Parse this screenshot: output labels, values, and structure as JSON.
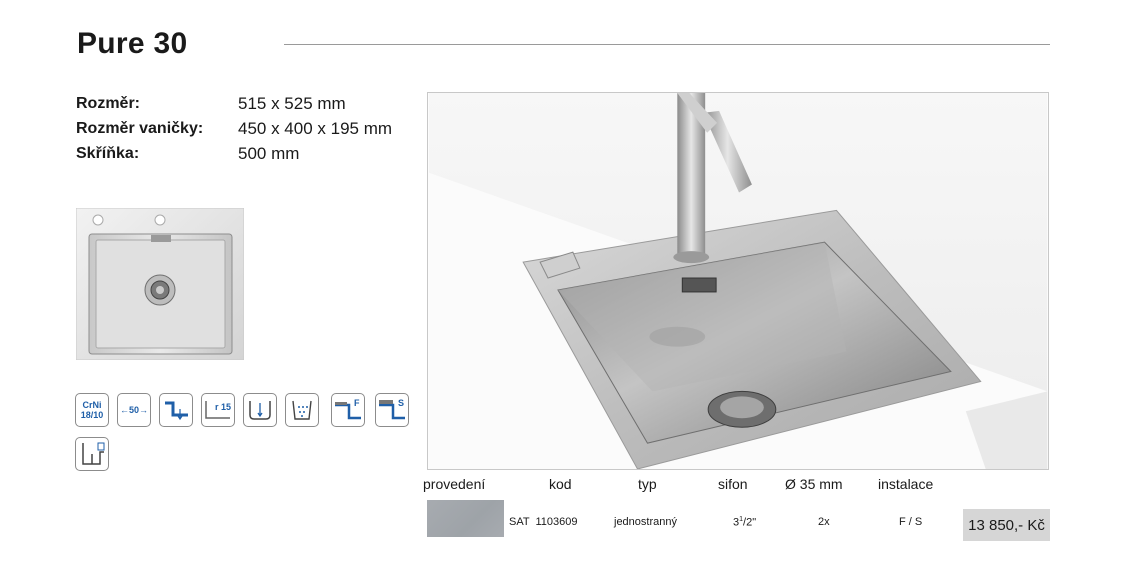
{
  "title": "Pure 30",
  "specs": [
    {
      "label": "Rozměr:",
      "value": "515 x 525 mm"
    },
    {
      "label": "Rozměr vaničky:",
      "value": "450 x 400 x 195 mm"
    },
    {
      "label": "Skříňka:",
      "value": "500 mm"
    }
  ],
  "feature_icons": {
    "crni": "CrNi 18/10",
    "dist": "←50→",
    "radius": "r 15",
    "flush": "F",
    "surface": "S"
  },
  "table": {
    "headers": [
      "provedení",
      "kod",
      "typ",
      "sifon",
      "Ø 35 mm",
      "instalace"
    ],
    "row": {
      "finish_color": "#a7abb0",
      "kod": "SAT  1103609",
      "typ": "jednostranný",
      "sifon_main": "3",
      "sifon_sup": "1",
      "sifon_tail": "/2\"",
      "holes": "2x",
      "instalace": "F / S",
      "price": "13 850,- Kč"
    }
  }
}
